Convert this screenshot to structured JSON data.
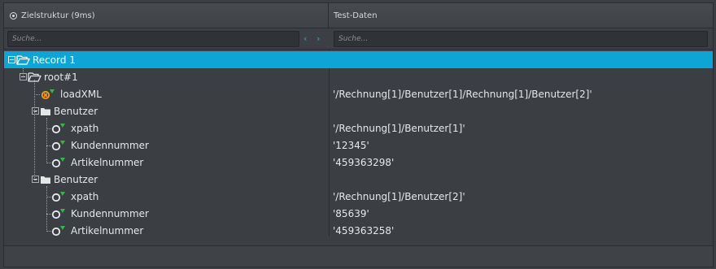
{
  "header": {
    "left_title": "Zielstruktur (9ms)",
    "right_title": "Test-Daten"
  },
  "search": {
    "left_placeholder": "Suche...",
    "right_placeholder": "Suche...",
    "prev_symbol": "‹",
    "next_symbol": "›"
  },
  "tree": {
    "record": {
      "label": "Record 1",
      "value": ""
    },
    "root": {
      "label": "root#1"
    },
    "loadxml": {
      "label": "loadXML",
      "value": "'/Rechnung[1]/Benutzer[1]/Rechnung[1]/Benutzer[2]'"
    },
    "groups": [
      {
        "label": "Benutzer",
        "fields": [
          {
            "label": "xpath",
            "value": "'/Rechnung[1]/Benutzer[1]'"
          },
          {
            "label": "Kundennummer",
            "value": "'12345'"
          },
          {
            "label": "Artikelnummer",
            "value": "'459363298'"
          }
        ]
      },
      {
        "label": "Benutzer",
        "fields": [
          {
            "label": "xpath",
            "value": "'/Rechnung[1]/Benutzer[2]'"
          },
          {
            "label": "Kundennummer",
            "value": "'85639'"
          },
          {
            "label": "Artikelnummer",
            "value": "'459363258'"
          }
        ]
      }
    ]
  },
  "colors": {
    "selection": "#0ea5d6",
    "accent_arrow": "#2fa4d9",
    "field_marker": "#39b54a",
    "mapped_node": "#f39c12"
  }
}
